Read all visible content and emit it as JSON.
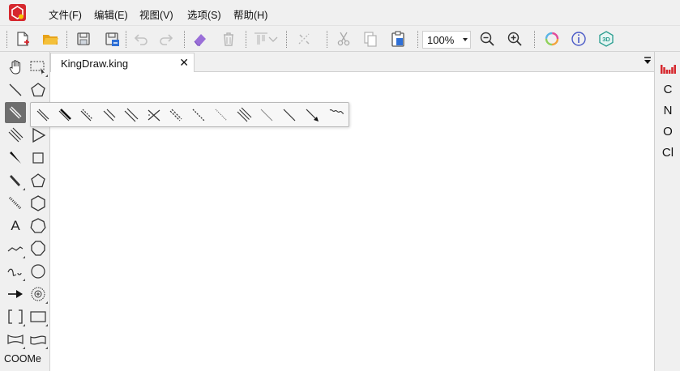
{
  "menubar": {
    "items": [
      {
        "label": "文件(F)"
      },
      {
        "label": "编辑(E)"
      },
      {
        "label": "视图(V)"
      },
      {
        "label": "选项(S)"
      },
      {
        "label": "帮助(H)"
      }
    ]
  },
  "toolbar": {
    "zoom_value": "100%"
  },
  "palette": {
    "template_label": "COOMe",
    "text_tool_label": "A"
  },
  "document": {
    "tab_title": "KingDraw.king",
    "close_glyph": "✕"
  },
  "element_panel": {
    "elements": [
      "C",
      "N",
      "O",
      "Cl"
    ]
  },
  "colors": {
    "brand_red": "#d6282e",
    "accent_blue": "#2e6fd6",
    "active_tool": "#6e6e6e"
  }
}
